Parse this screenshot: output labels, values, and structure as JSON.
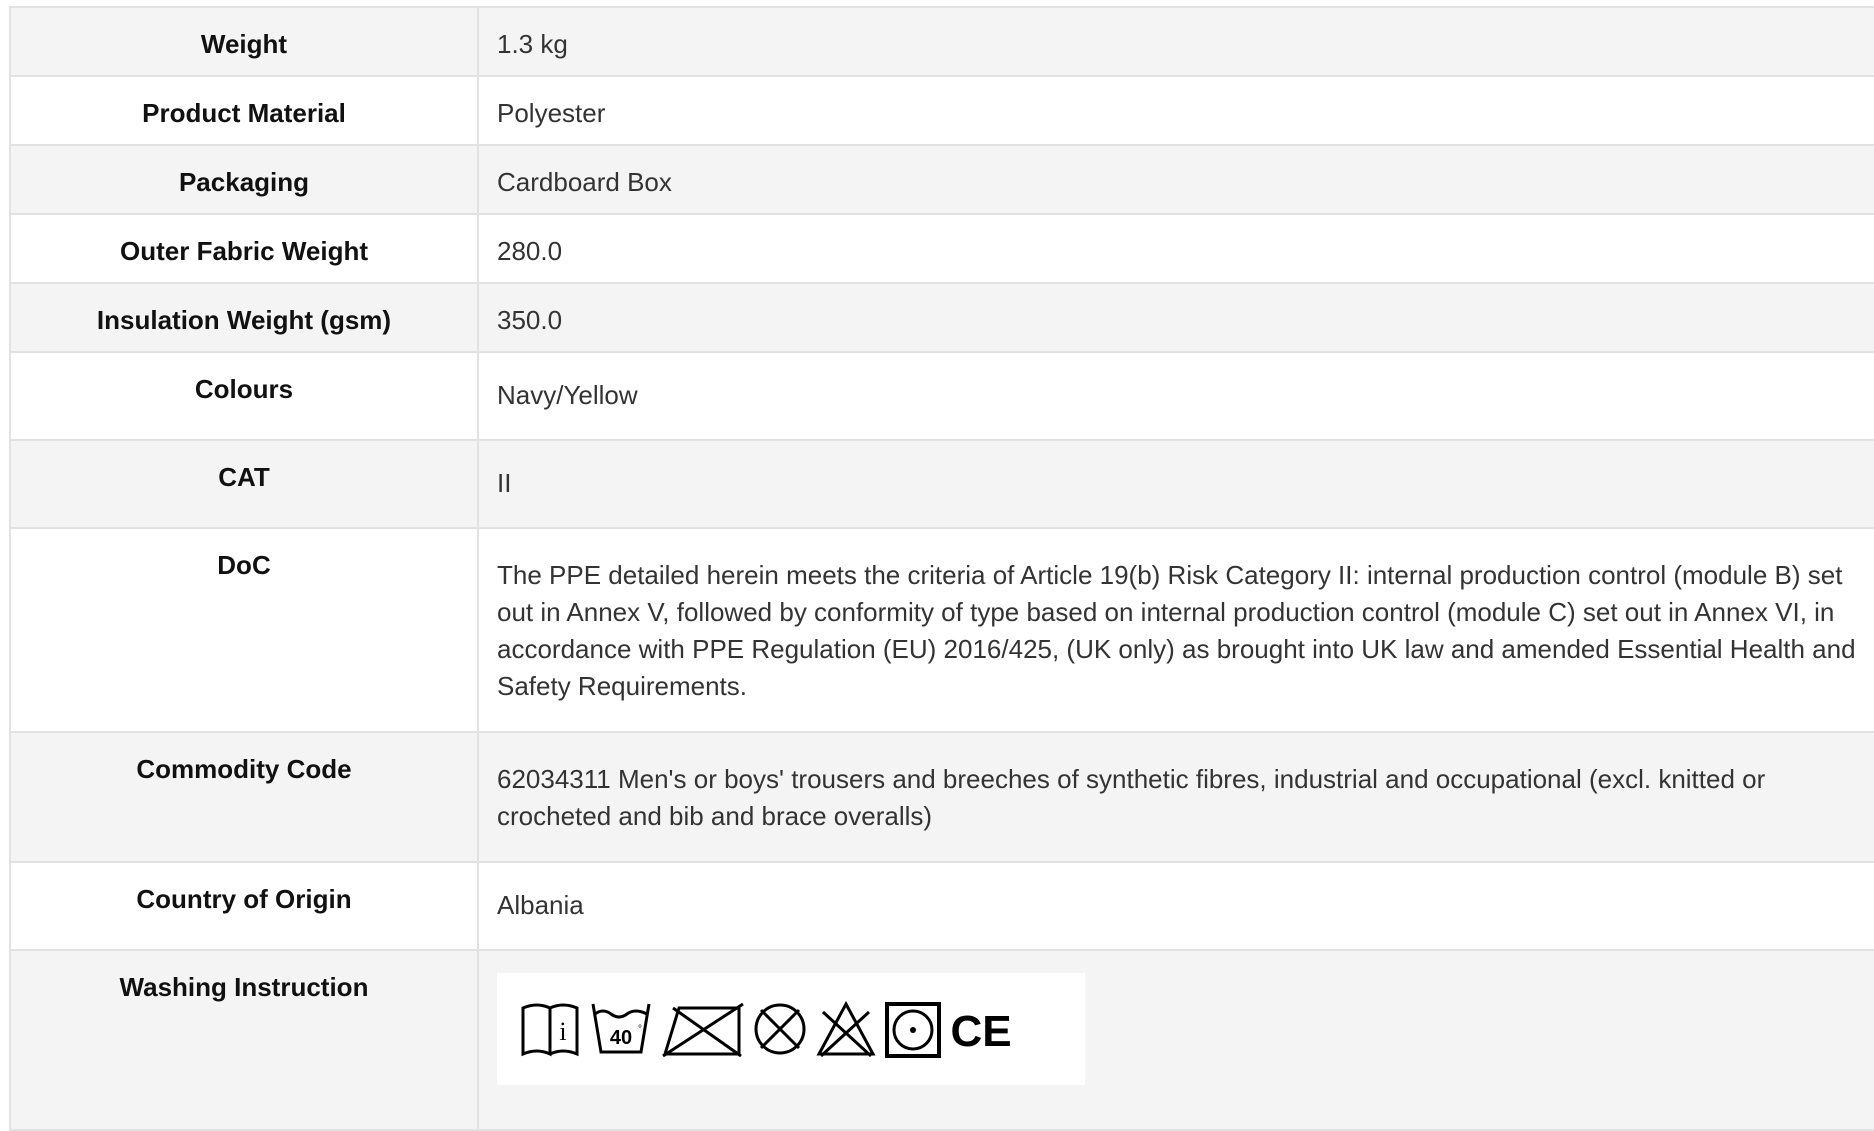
{
  "specs": [
    {
      "label": "Weight",
      "value": "1.3 kg"
    },
    {
      "label": "Product Material",
      "value": "Polyester"
    },
    {
      "label": "Packaging",
      "value": "Cardboard Box"
    },
    {
      "label": "Outer Fabric Weight",
      "value": "280.0"
    },
    {
      "label": "Insulation Weight (gsm)",
      "value": "350.0"
    },
    {
      "label": "Colours",
      "value": "Navy/Yellow"
    },
    {
      "label": "CAT",
      "value": "II"
    },
    {
      "label": "DoC",
      "value": "The PPE detailed herein meets the criteria of Article 19(b) Risk Category II: internal production control (module B) set out in Annex V, followed by conformity of type based on internal production control (module C) set out in Annex VI, in accordance with PPE Regulation (EU) 2016/425, (UK only) as brought into UK law and amended Essential Health and Safety Requirements."
    },
    {
      "label": "Commodity Code",
      "value": "62034311 Men's or boys' trousers and breeches of synthetic fibres, industrial and occupational (excl. knitted or crocheted and bib and brace overalls)"
    },
    {
      "label": "Country of Origin",
      "value": "Albania"
    },
    {
      "label": "Washing Instruction"
    }
  ],
  "washing_icons": {
    "wash_temperature": "40",
    "ce_mark": "CE",
    "icons": [
      "read-instructions-icon",
      "wash-40-icon",
      "do-not-iron-icon",
      "do-not-dry-clean-icon",
      "do-not-bleach-icon",
      "tumble-dry-icon",
      "ce-mark-icon"
    ]
  }
}
